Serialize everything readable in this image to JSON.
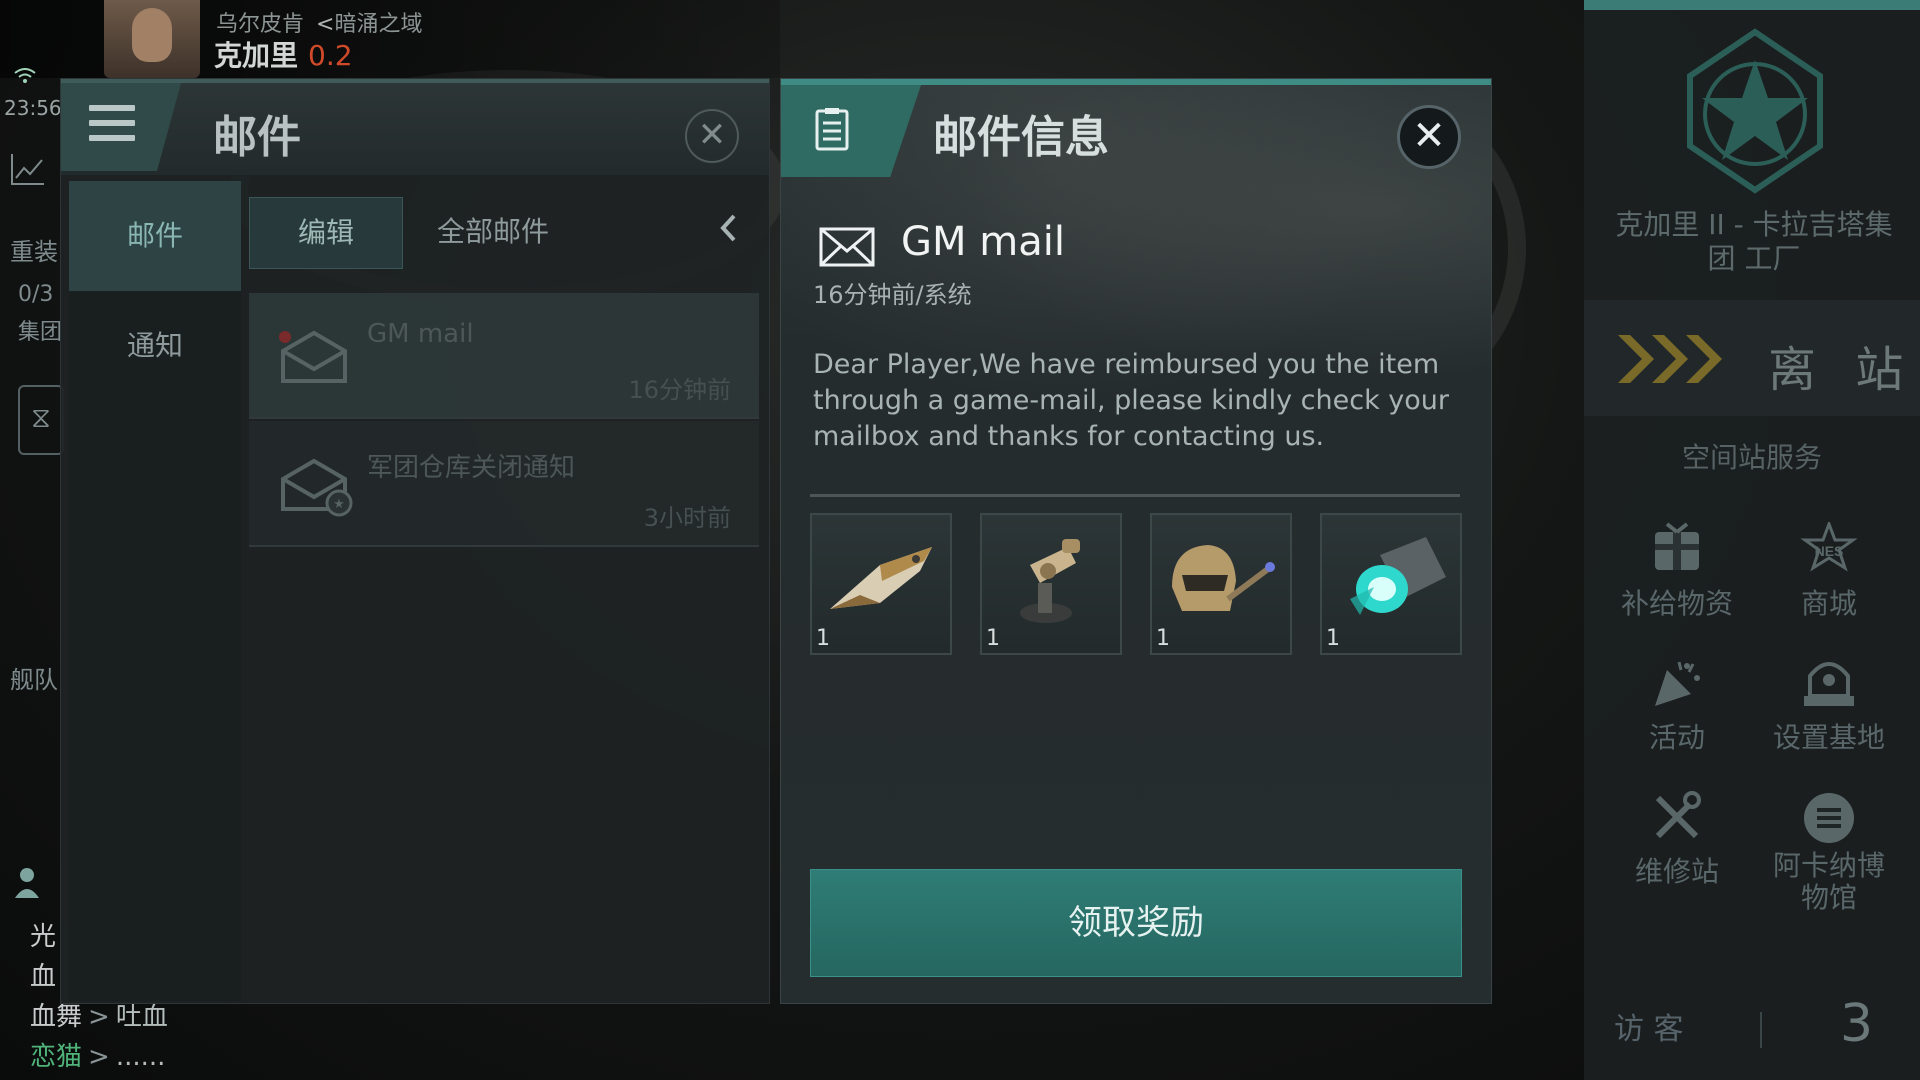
{
  "hud": {
    "region": "乌尔皮肯",
    "constellation_arrow": "<",
    "constellation": "暗涌之域",
    "system": "克加里",
    "security": "0.2",
    "time": "23:56"
  },
  "sidebar_fragments": [
    "重装",
    "0/3",
    "集团",
    "舰队"
  ],
  "chat": [
    {
      "name": "光",
      "arrow": "",
      "msg": ""
    },
    {
      "name": "血",
      "arrow": "",
      "msg": ""
    },
    {
      "name": "血舞",
      "arrow": ">",
      "msg": "吐血"
    },
    {
      "name": "恋猫",
      "arrow": ">",
      "msg": "......"
    }
  ],
  "mail_panel": {
    "title": "邮件",
    "nav": [
      {
        "label": "邮件",
        "active": true
      },
      {
        "label": "通知",
        "active": false
      }
    ],
    "edit_label": "编辑",
    "all_mail_label": "全部邮件",
    "items": [
      {
        "title": "GM mail",
        "time": "16分钟前"
      },
      {
        "title": "军团仓库关闭通知",
        "time": "3小时前"
      }
    ]
  },
  "detail": {
    "title": "邮件信息",
    "subject": "GM mail",
    "meta": "16分钟前/系统",
    "body": "Dear Player,We have reimbursed you the item through a game-mail, please kindly check your mailbox and thanks for contacting us.",
    "items": [
      {
        "icon": "ship-icon",
        "qty": "1"
      },
      {
        "icon": "turret-icon",
        "qty": "1"
      },
      {
        "icon": "helmet-drill-icon",
        "qty": "1"
      },
      {
        "icon": "thruster-module-icon",
        "qty": "1"
      }
    ],
    "claim_label": "领取奖励"
  },
  "station": {
    "name": "克加里 II - 卡拉吉塔集团 工厂",
    "undock_label": "离 站",
    "services_title": "空间站服务",
    "services": [
      {
        "icon": "supply-box-icon",
        "label": "补给物资"
      },
      {
        "icon": "nes-store-icon",
        "label": "商城"
      },
      {
        "icon": "party-popper-icon",
        "label": "活动"
      },
      {
        "icon": "base-icon",
        "label": "设置基地"
      },
      {
        "icon": "repair-tools-icon",
        "label": "维修站"
      },
      {
        "icon": "museum-icon",
        "label": "阿卡纳博物馆"
      }
    ],
    "visitor_label": "访 客",
    "visitor_count": "3"
  },
  "colors": {
    "accent_teal": "#2f7d76",
    "security_red": "#d04a2a",
    "chat_green": "#4fb37a"
  }
}
